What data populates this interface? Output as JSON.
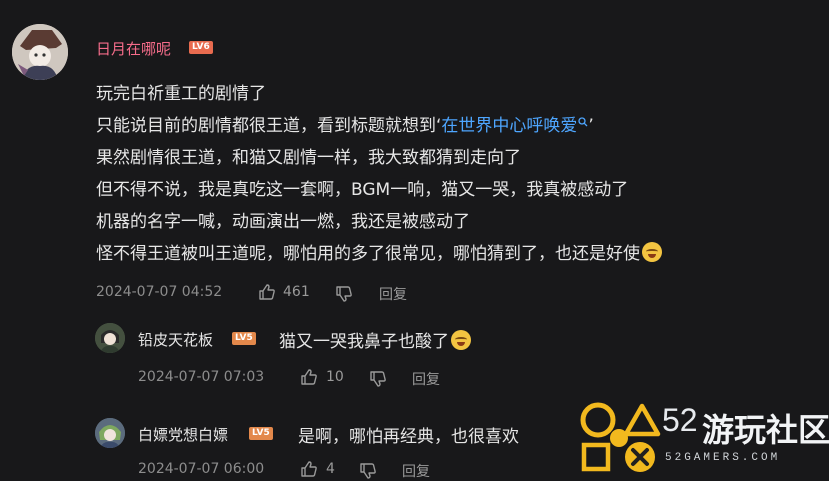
{
  "main_comment": {
    "username": "日月在哪呢",
    "level": "LV6",
    "lines": [
      "玩完白祈重工的剧情了",
      "只能说目前的剧情都很王道，看到标题就想到‘",
      "果然剧情很王道，和猫又剧情一样，我大致都猜到走向了",
      "但不得不说，我是真吃这一套啊，BGM一响，猫又一哭，我真被感动了",
      "机器的名字一喊，动画演出一燃，我还是被感动了",
      "怪不得王道被叫王道呢，哪怕用的多了很常见，哪怕猜到了，也还是好使"
    ],
    "link_text": "在世界中心呼唤爱",
    "link_suffix": "’",
    "date": "2024-07-07 04:52",
    "likes": "461",
    "reply_label": "回复"
  },
  "replies": [
    {
      "username": "铅皮天花板",
      "level": "LV5",
      "text": "猫又一哭我鼻子也酸了",
      "date": "2024-07-07 07:03",
      "likes": "10",
      "reply_label": "回复"
    },
    {
      "username": "白嫖党想白嫖",
      "level": "LV5",
      "text": "是啊，哪怕再经典，也很喜欢",
      "date": "2024-07-07 06:00",
      "likes": "4",
      "reply_label": "回复"
    }
  ],
  "watermark": {
    "number": "52",
    "name": "游玩社区",
    "domain": "52GAMERS.COM"
  },
  "colors": {
    "background": "#18181a",
    "username_main": "#f56c8a",
    "username_reply": "#e6e6e6",
    "link": "#4ea6ff",
    "meta": "#8d8d8d"
  }
}
